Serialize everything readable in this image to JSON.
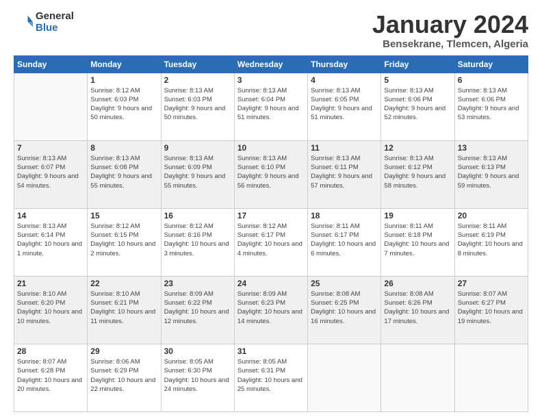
{
  "logo": {
    "general": "General",
    "blue": "Blue"
  },
  "title": "January 2024",
  "location": "Bensekrane, Tlemcen, Algeria",
  "days_header": [
    "Sunday",
    "Monday",
    "Tuesday",
    "Wednesday",
    "Thursday",
    "Friday",
    "Saturday"
  ],
  "weeks": [
    [
      {
        "day": "",
        "sunrise": "",
        "sunset": "",
        "daylight": ""
      },
      {
        "day": "1",
        "sunrise": "Sunrise: 8:12 AM",
        "sunset": "Sunset: 6:03 PM",
        "daylight": "Daylight: 9 hours and 50 minutes."
      },
      {
        "day": "2",
        "sunrise": "Sunrise: 8:13 AM",
        "sunset": "Sunset: 6:03 PM",
        "daylight": "Daylight: 9 hours and 50 minutes."
      },
      {
        "day": "3",
        "sunrise": "Sunrise: 8:13 AM",
        "sunset": "Sunset: 6:04 PM",
        "daylight": "Daylight: 9 hours and 51 minutes."
      },
      {
        "day": "4",
        "sunrise": "Sunrise: 8:13 AM",
        "sunset": "Sunset: 6:05 PM",
        "daylight": "Daylight: 9 hours and 51 minutes."
      },
      {
        "day": "5",
        "sunrise": "Sunrise: 8:13 AM",
        "sunset": "Sunset: 6:06 PM",
        "daylight": "Daylight: 9 hours and 52 minutes."
      },
      {
        "day": "6",
        "sunrise": "Sunrise: 8:13 AM",
        "sunset": "Sunset: 6:06 PM",
        "daylight": "Daylight: 9 hours and 53 minutes."
      }
    ],
    [
      {
        "day": "7",
        "sunrise": "Sunrise: 8:13 AM",
        "sunset": "Sunset: 6:07 PM",
        "daylight": "Daylight: 9 hours and 54 minutes."
      },
      {
        "day": "8",
        "sunrise": "Sunrise: 8:13 AM",
        "sunset": "Sunset: 6:08 PM",
        "daylight": "Daylight: 9 hours and 55 minutes."
      },
      {
        "day": "9",
        "sunrise": "Sunrise: 8:13 AM",
        "sunset": "Sunset: 6:09 PM",
        "daylight": "Daylight: 9 hours and 55 minutes."
      },
      {
        "day": "10",
        "sunrise": "Sunrise: 8:13 AM",
        "sunset": "Sunset: 6:10 PM",
        "daylight": "Daylight: 9 hours and 56 minutes."
      },
      {
        "day": "11",
        "sunrise": "Sunrise: 8:13 AM",
        "sunset": "Sunset: 6:11 PM",
        "daylight": "Daylight: 9 hours and 57 minutes."
      },
      {
        "day": "12",
        "sunrise": "Sunrise: 8:13 AM",
        "sunset": "Sunset: 6:12 PM",
        "daylight": "Daylight: 9 hours and 58 minutes."
      },
      {
        "day": "13",
        "sunrise": "Sunrise: 8:13 AM",
        "sunset": "Sunset: 6:13 PM",
        "daylight": "Daylight: 9 hours and 59 minutes."
      }
    ],
    [
      {
        "day": "14",
        "sunrise": "Sunrise: 8:13 AM",
        "sunset": "Sunset: 6:14 PM",
        "daylight": "Daylight: 10 hours and 1 minute."
      },
      {
        "day": "15",
        "sunrise": "Sunrise: 8:12 AM",
        "sunset": "Sunset: 6:15 PM",
        "daylight": "Daylight: 10 hours and 2 minutes."
      },
      {
        "day": "16",
        "sunrise": "Sunrise: 8:12 AM",
        "sunset": "Sunset: 6:16 PM",
        "daylight": "Daylight: 10 hours and 3 minutes."
      },
      {
        "day": "17",
        "sunrise": "Sunrise: 8:12 AM",
        "sunset": "Sunset: 6:17 PM",
        "daylight": "Daylight: 10 hours and 4 minutes."
      },
      {
        "day": "18",
        "sunrise": "Sunrise: 8:11 AM",
        "sunset": "Sunset: 6:17 PM",
        "daylight": "Daylight: 10 hours and 6 minutes."
      },
      {
        "day": "19",
        "sunrise": "Sunrise: 8:11 AM",
        "sunset": "Sunset: 6:18 PM",
        "daylight": "Daylight: 10 hours and 7 minutes."
      },
      {
        "day": "20",
        "sunrise": "Sunrise: 8:11 AM",
        "sunset": "Sunset: 6:19 PM",
        "daylight": "Daylight: 10 hours and 8 minutes."
      }
    ],
    [
      {
        "day": "21",
        "sunrise": "Sunrise: 8:10 AM",
        "sunset": "Sunset: 6:20 PM",
        "daylight": "Daylight: 10 hours and 10 minutes."
      },
      {
        "day": "22",
        "sunrise": "Sunrise: 8:10 AM",
        "sunset": "Sunset: 6:21 PM",
        "daylight": "Daylight: 10 hours and 11 minutes."
      },
      {
        "day": "23",
        "sunrise": "Sunrise: 8:09 AM",
        "sunset": "Sunset: 6:22 PM",
        "daylight": "Daylight: 10 hours and 12 minutes."
      },
      {
        "day": "24",
        "sunrise": "Sunrise: 8:09 AM",
        "sunset": "Sunset: 6:23 PM",
        "daylight": "Daylight: 10 hours and 14 minutes."
      },
      {
        "day": "25",
        "sunrise": "Sunrise: 8:08 AM",
        "sunset": "Sunset: 6:25 PM",
        "daylight": "Daylight: 10 hours and 16 minutes."
      },
      {
        "day": "26",
        "sunrise": "Sunrise: 8:08 AM",
        "sunset": "Sunset: 6:26 PM",
        "daylight": "Daylight: 10 hours and 17 minutes."
      },
      {
        "day": "27",
        "sunrise": "Sunrise: 8:07 AM",
        "sunset": "Sunset: 6:27 PM",
        "daylight": "Daylight: 10 hours and 19 minutes."
      }
    ],
    [
      {
        "day": "28",
        "sunrise": "Sunrise: 8:07 AM",
        "sunset": "Sunset: 6:28 PM",
        "daylight": "Daylight: 10 hours and 20 minutes."
      },
      {
        "day": "29",
        "sunrise": "Sunrise: 8:06 AM",
        "sunset": "Sunset: 6:29 PM",
        "daylight": "Daylight: 10 hours and 22 minutes."
      },
      {
        "day": "30",
        "sunrise": "Sunrise: 8:05 AM",
        "sunset": "Sunset: 6:30 PM",
        "daylight": "Daylight: 10 hours and 24 minutes."
      },
      {
        "day": "31",
        "sunrise": "Sunrise: 8:05 AM",
        "sunset": "Sunset: 6:31 PM",
        "daylight": "Daylight: 10 hours and 25 minutes."
      },
      {
        "day": "",
        "sunrise": "",
        "sunset": "",
        "daylight": ""
      },
      {
        "day": "",
        "sunrise": "",
        "sunset": "",
        "daylight": ""
      },
      {
        "day": "",
        "sunrise": "",
        "sunset": "",
        "daylight": ""
      }
    ]
  ]
}
